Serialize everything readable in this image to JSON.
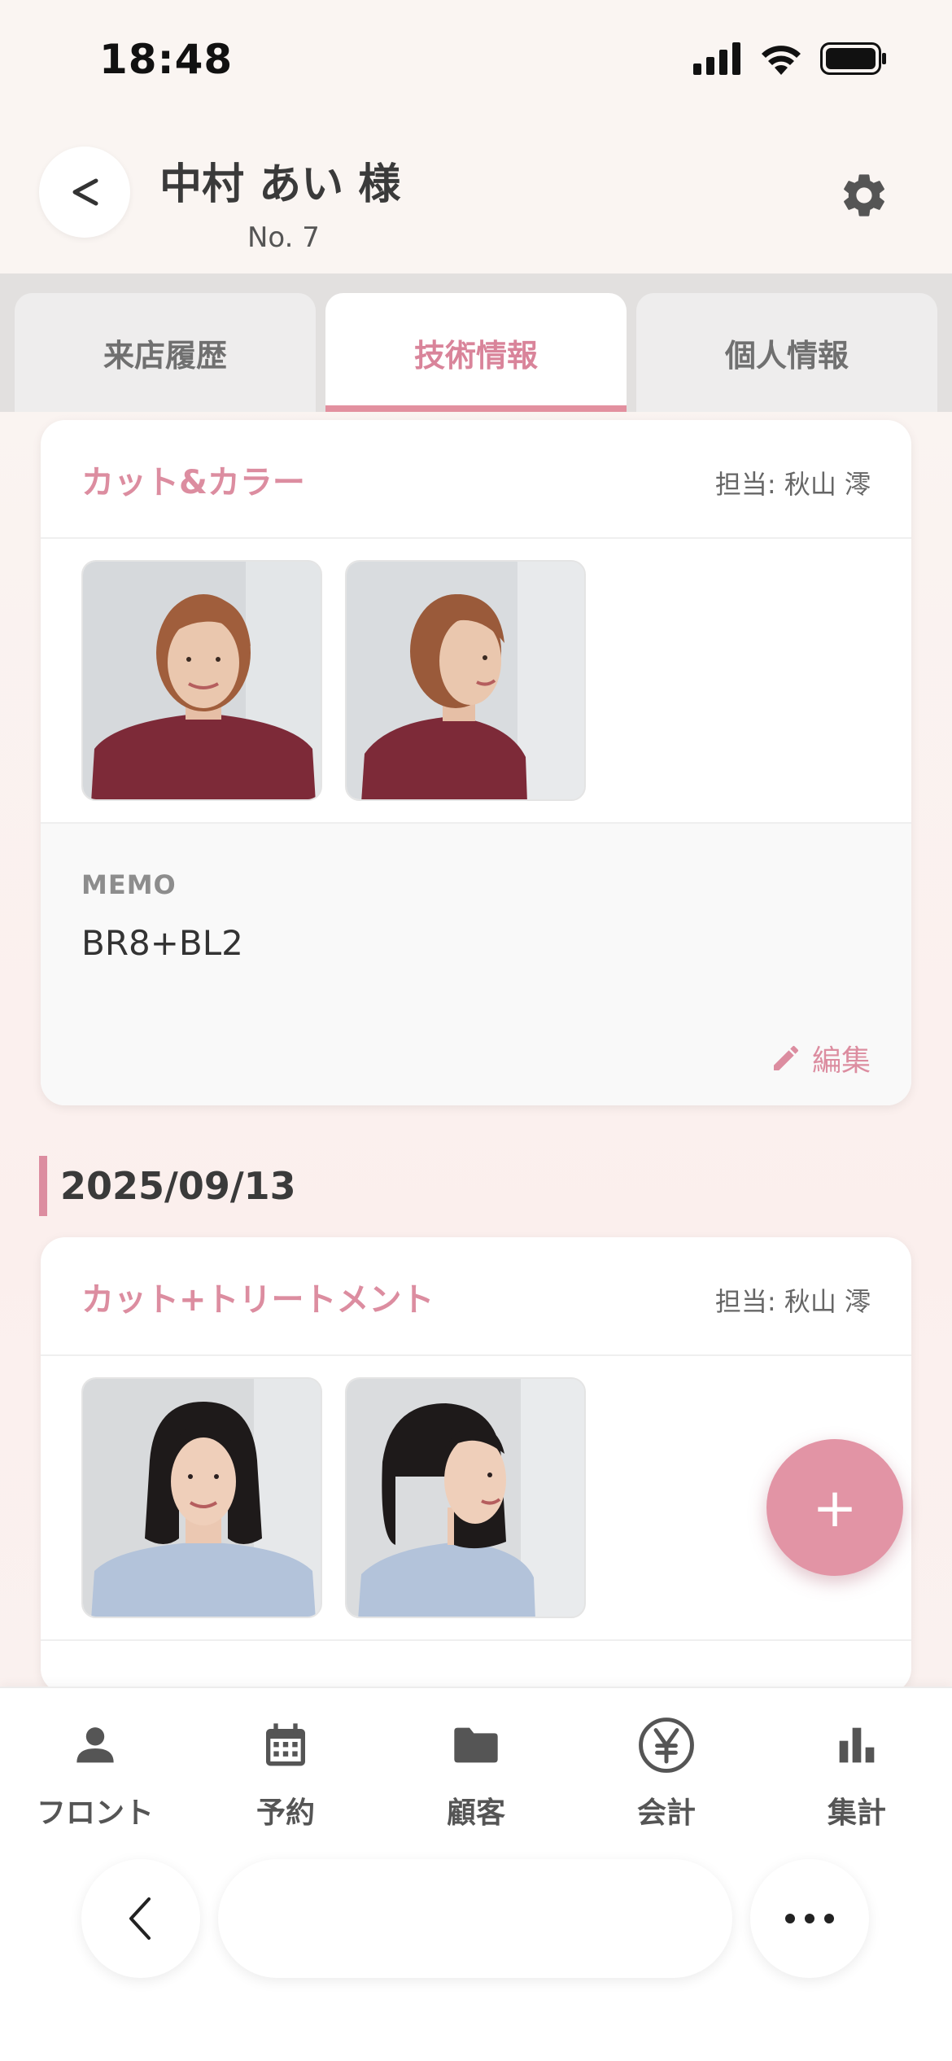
{
  "status_bar": {
    "time": "18:48"
  },
  "header": {
    "customer_name": "中村 あい 様",
    "customer_no": "No. 7"
  },
  "tabs": [
    {
      "label": "来店履歴",
      "active": false
    },
    {
      "label": "技術情報",
      "active": true
    },
    {
      "label": "個人情報",
      "active": false
    }
  ],
  "records": [
    {
      "service": "カット&カラー",
      "staff": "担当: 秋山 澪",
      "photos": [
        "front-view-short-bob-burgundy-sweater",
        "side-view-short-bob-burgundy-sweater"
      ],
      "memo_label": "MEMO",
      "memo": "BR8+BL2",
      "edit_label": "編集"
    },
    {
      "date": "2025/09/13",
      "service": "カット+トリートメント",
      "staff": "担当: 秋山 澪",
      "photos": [
        "front-view-black-bob-blue-sweater",
        "side-view-black-bob-blue-sweater"
      ]
    }
  ],
  "fab_label": "+",
  "bottom_nav": [
    {
      "label": "フロント",
      "icon": "person-icon"
    },
    {
      "label": "予約",
      "icon": "calendar-icon"
    },
    {
      "label": "顧客",
      "icon": "folder-icon"
    },
    {
      "label": "会計",
      "icon": "yen-icon"
    },
    {
      "label": "集計",
      "icon": "bar-chart-icon"
    }
  ],
  "colors": {
    "accent": "#dc8da0",
    "fab": "#e294a5"
  }
}
